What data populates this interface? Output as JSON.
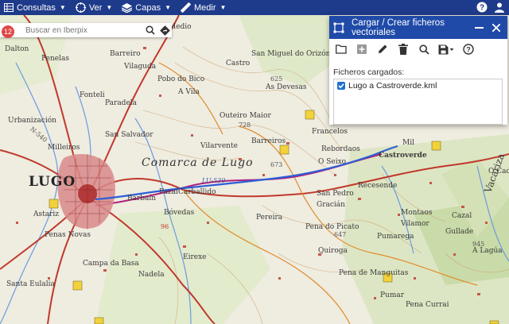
{
  "topbar": {
    "menus": [
      {
        "label": "Consultas",
        "icon": "table-icon"
      },
      {
        "label": "Ver",
        "icon": "compass-icon"
      },
      {
        "label": "Capas",
        "icon": "layers-icon"
      },
      {
        "label": "Medir",
        "icon": "ruler-icon"
      }
    ],
    "right_icons": [
      "help-icon",
      "user-icon"
    ]
  },
  "search": {
    "placeholder": "Buscar en Iberpix",
    "badge": "12"
  },
  "panel": {
    "title": "Cargar / Crear ficheros vectoriales",
    "tools": [
      "folder-open-icon",
      "add-layer-icon",
      "pencil-icon",
      "trash-icon",
      "search-icon",
      "save-icon",
      "help-icon"
    ],
    "files_label": "Ficheros cargados:",
    "files": [
      {
        "name": "Lugo a Castroverde.kml",
        "checked": true
      }
    ]
  },
  "colors": {
    "topbar": "#1e3a8a",
    "panel_header": "#1f4aa8",
    "route": "#2b5fd9",
    "arrow": "#d62020"
  },
  "map_labels": {
    "lugo": "LUGO",
    "comarca": "Comarca de Lugo",
    "castroverde": "Castroverde",
    "a_vila": "A Vila",
    "outeiro_maior": "Outeiro Maior",
    "barbain": "Barbaín",
    "carballido": "Carballido",
    "fazai": "Fazai",
    "bovedas": "Bóvedas",
    "vilarvente": "Vilarvente",
    "barreiros": "Barreiros",
    "pena_picato": "Pena do Picato",
    "recesende": "Recesende",
    "campa": "Campa da Basa",
    "santa_eulalia": "Santa Eulalia",
    "castro": "Castro",
    "medio": "Medio",
    "dalton": "Dalton",
    "penelas": "Penelas",
    "barreiro": "Barreiro",
    "vilaguda": "Vilaguda",
    "fonteli": "Fonteli",
    "paradela": "Paradela",
    "pobo_bico": "Pobo do Bico",
    "milleiros": "Milleiros",
    "salvador": "San Salvador",
    "urbanizacion": "Urbanización",
    "astariz": "Astariz",
    "penas_novas": "Penas Novas",
    "eirexe": "Eirexe",
    "as_devesas": "As Devesas",
    "orizon": "San Miguel do Orizón",
    "o_seixo": "O Seixo",
    "francelos": "Francelos",
    "rebordaos": "Rebordaos",
    "mil": "Mil",
    "san_pedro": "San Pedro",
    "gracian": "Gracián",
    "montaos": "Montaos",
    "pereira": "Pereira",
    "quiroga": "Quiroga",
    "vilamor": "Vilamor",
    "pumarega": "Pumarega",
    "gullade": "Gullade",
    "cazal": "Cazal",
    "manguitas": "Pena de Manguitas",
    "pena_currai": "Pena Currai",
    "vacaria": "Vacariza",
    "a_lagua": "A Lagúa",
    "pumar": "Pumar",
    "nadela": "Nadela",
    "o_cadro": "O Cad",
    "elev_625": "625",
    "elev_728": "728",
    "elev_673": "673",
    "elev_647": "647",
    "elev_945": "945",
    "lu_530": "LU-530",
    "n540": "N-540",
    "num_96": "96"
  }
}
